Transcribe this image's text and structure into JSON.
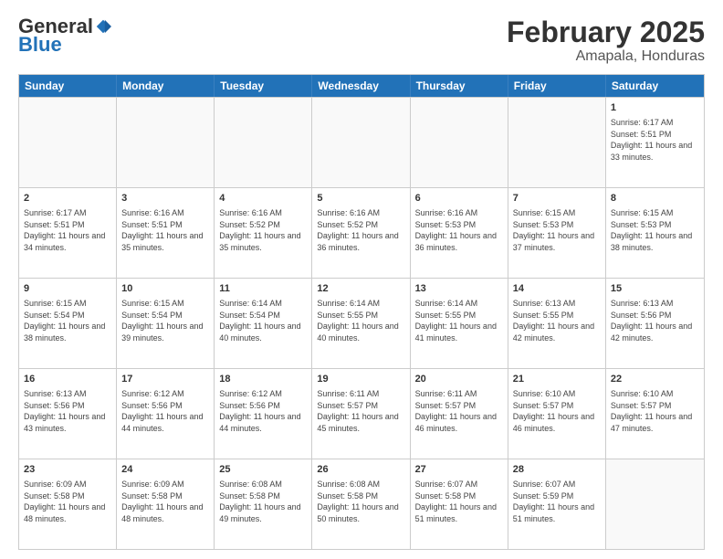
{
  "logo": {
    "general": "General",
    "blue": "Blue"
  },
  "title": "February 2025",
  "subtitle": "Amapala, Honduras",
  "days": [
    "Sunday",
    "Monday",
    "Tuesday",
    "Wednesday",
    "Thursday",
    "Friday",
    "Saturday"
  ],
  "weeks": [
    [
      {
        "day": "",
        "empty": true
      },
      {
        "day": "",
        "empty": true
      },
      {
        "day": "",
        "empty": true
      },
      {
        "day": "",
        "empty": true
      },
      {
        "day": "",
        "empty": true
      },
      {
        "day": "",
        "empty": true
      },
      {
        "day": "1",
        "sunrise": "6:17 AM",
        "sunset": "5:51 PM",
        "daylight": "11 hours and 33 minutes."
      }
    ],
    [
      {
        "day": "2",
        "sunrise": "6:17 AM",
        "sunset": "5:51 PM",
        "daylight": "11 hours and 34 minutes."
      },
      {
        "day": "3",
        "sunrise": "6:16 AM",
        "sunset": "5:51 PM",
        "daylight": "11 hours and 35 minutes."
      },
      {
        "day": "4",
        "sunrise": "6:16 AM",
        "sunset": "5:52 PM",
        "daylight": "11 hours and 35 minutes."
      },
      {
        "day": "5",
        "sunrise": "6:16 AM",
        "sunset": "5:52 PM",
        "daylight": "11 hours and 36 minutes."
      },
      {
        "day": "6",
        "sunrise": "6:16 AM",
        "sunset": "5:53 PM",
        "daylight": "11 hours and 36 minutes."
      },
      {
        "day": "7",
        "sunrise": "6:15 AM",
        "sunset": "5:53 PM",
        "daylight": "11 hours and 37 minutes."
      },
      {
        "day": "8",
        "sunrise": "6:15 AM",
        "sunset": "5:53 PM",
        "daylight": "11 hours and 38 minutes."
      }
    ],
    [
      {
        "day": "9",
        "sunrise": "6:15 AM",
        "sunset": "5:54 PM",
        "daylight": "11 hours and 38 minutes."
      },
      {
        "day": "10",
        "sunrise": "6:15 AM",
        "sunset": "5:54 PM",
        "daylight": "11 hours and 39 minutes."
      },
      {
        "day": "11",
        "sunrise": "6:14 AM",
        "sunset": "5:54 PM",
        "daylight": "11 hours and 40 minutes."
      },
      {
        "day": "12",
        "sunrise": "6:14 AM",
        "sunset": "5:55 PM",
        "daylight": "11 hours and 40 minutes."
      },
      {
        "day": "13",
        "sunrise": "6:14 AM",
        "sunset": "5:55 PM",
        "daylight": "11 hours and 41 minutes."
      },
      {
        "day": "14",
        "sunrise": "6:13 AM",
        "sunset": "5:55 PM",
        "daylight": "11 hours and 42 minutes."
      },
      {
        "day": "15",
        "sunrise": "6:13 AM",
        "sunset": "5:56 PM",
        "daylight": "11 hours and 42 minutes."
      }
    ],
    [
      {
        "day": "16",
        "sunrise": "6:13 AM",
        "sunset": "5:56 PM",
        "daylight": "11 hours and 43 minutes."
      },
      {
        "day": "17",
        "sunrise": "6:12 AM",
        "sunset": "5:56 PM",
        "daylight": "11 hours and 44 minutes."
      },
      {
        "day": "18",
        "sunrise": "6:12 AM",
        "sunset": "5:56 PM",
        "daylight": "11 hours and 44 minutes."
      },
      {
        "day": "19",
        "sunrise": "6:11 AM",
        "sunset": "5:57 PM",
        "daylight": "11 hours and 45 minutes."
      },
      {
        "day": "20",
        "sunrise": "6:11 AM",
        "sunset": "5:57 PM",
        "daylight": "11 hours and 46 minutes."
      },
      {
        "day": "21",
        "sunrise": "6:10 AM",
        "sunset": "5:57 PM",
        "daylight": "11 hours and 46 minutes."
      },
      {
        "day": "22",
        "sunrise": "6:10 AM",
        "sunset": "5:57 PM",
        "daylight": "11 hours and 47 minutes."
      }
    ],
    [
      {
        "day": "23",
        "sunrise": "6:09 AM",
        "sunset": "5:58 PM",
        "daylight": "11 hours and 48 minutes."
      },
      {
        "day": "24",
        "sunrise": "6:09 AM",
        "sunset": "5:58 PM",
        "daylight": "11 hours and 48 minutes."
      },
      {
        "day": "25",
        "sunrise": "6:08 AM",
        "sunset": "5:58 PM",
        "daylight": "11 hours and 49 minutes."
      },
      {
        "day": "26",
        "sunrise": "6:08 AM",
        "sunset": "5:58 PM",
        "daylight": "11 hours and 50 minutes."
      },
      {
        "day": "27",
        "sunrise": "6:07 AM",
        "sunset": "5:58 PM",
        "daylight": "11 hours and 51 minutes."
      },
      {
        "day": "28",
        "sunrise": "6:07 AM",
        "sunset": "5:59 PM",
        "daylight": "11 hours and 51 minutes."
      },
      {
        "day": "",
        "empty": true
      }
    ]
  ]
}
